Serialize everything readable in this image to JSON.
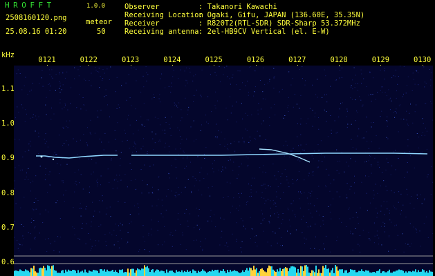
{
  "header": {
    "brand": "HROFFT",
    "version": "1.0.0",
    "filename": "2508160120.png",
    "datetime": "25.08.16 01:20",
    "detection_label": "meteor",
    "detection_count": "50",
    "observer_label": "Observer",
    "observer_value": ": Takanori Kawachi",
    "location_label": "Receiving Location",
    "location_value": ": Ogaki, Gifu, JAPAN (136.60E, 35.35N)",
    "receiver_label": "Receiver",
    "receiver_value": ": R820T2(RTL-SDR) SDR-Sharp 53.372MHz",
    "antenna_label": "Receiving antenna",
    "antenna_value": ": 2el-HB9CV Vertical (el. E-W)"
  },
  "axis": {
    "unit": "kHz",
    "x_ticks": [
      "0121",
      "0122",
      "0123",
      "0124",
      "0125",
      "0126",
      "0127",
      "0128",
      "0129",
      "0130"
    ],
    "y_ticks": [
      "1.1",
      "1.0",
      "0.9",
      "0.8",
      "0.7",
      "0.6"
    ]
  },
  "colors": {
    "text_yellow": "#ffff3c",
    "text_green": "#33e033",
    "background": "#04062c",
    "signal": "#8fd6ff"
  }
}
